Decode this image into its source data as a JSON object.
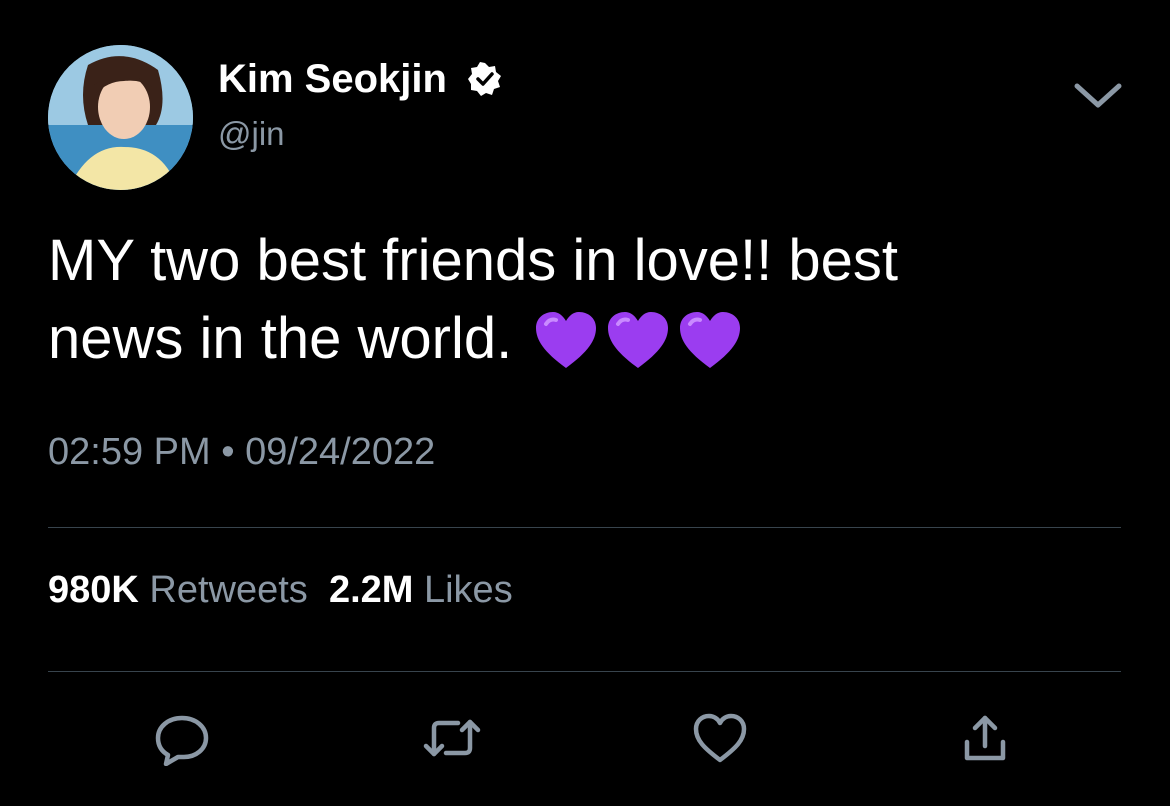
{
  "tweet": {
    "author": {
      "display_name": "Kim Seokjin",
      "handle": "@jin",
      "verified": true
    },
    "text_line1": "MY two best friends in love!! best",
    "text_line2": "news in the world.",
    "emoji": [
      "purple-heart",
      "purple-heart",
      "purple-heart"
    ],
    "time": "02:59 PM",
    "separator": "•",
    "date": "09/24/2022",
    "retweets_count": "980K",
    "retweets_label": "Retweets",
    "likes_count": "2.2M",
    "likes_label": "Likes"
  },
  "icons": {
    "menu": "chevron-down-icon",
    "reply": "reply-icon",
    "retweet": "retweet-icon",
    "like": "like-icon",
    "share": "share-icon"
  },
  "colors": {
    "background": "#000000",
    "text": "#ffffff",
    "secondary_text": "#8b98a5",
    "divider": "#38444d",
    "emoji_purple": "#9b3df0"
  }
}
